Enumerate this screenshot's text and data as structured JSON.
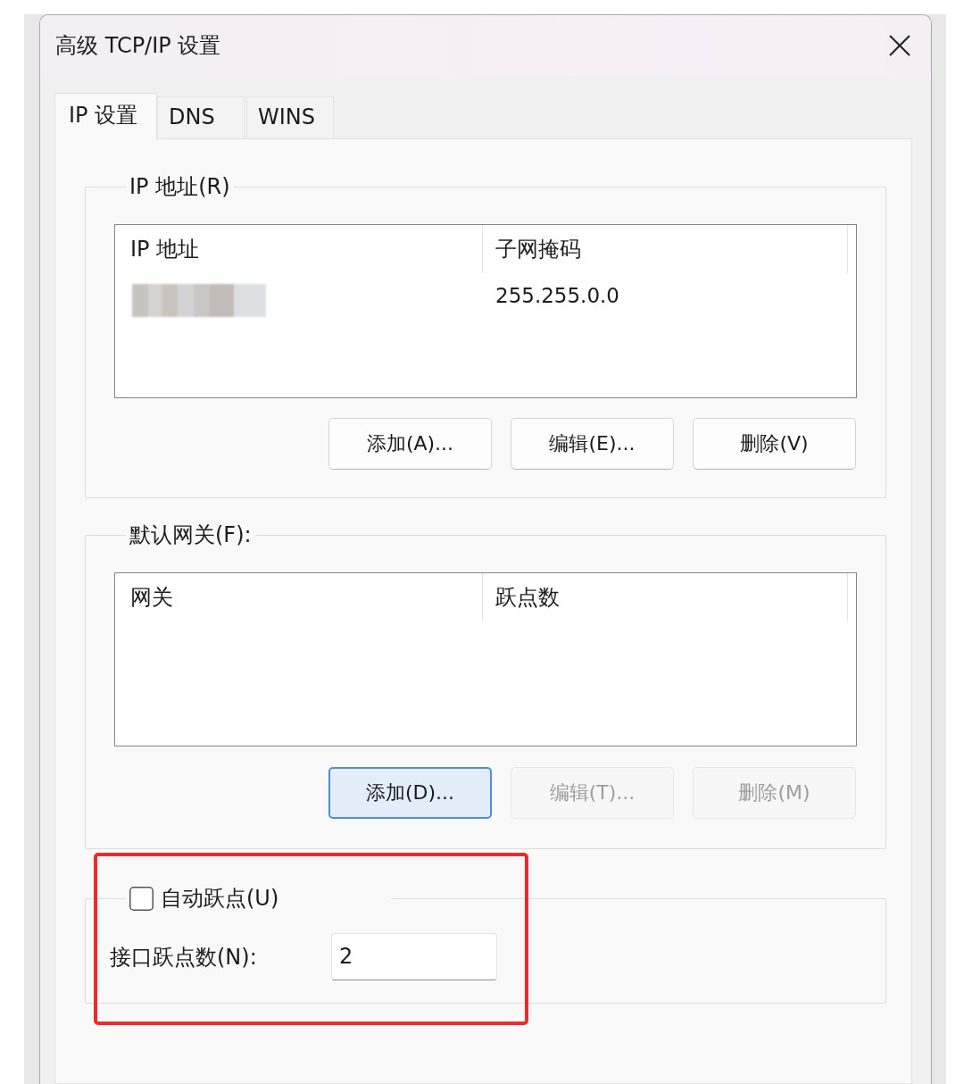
{
  "window": {
    "title": "高级 TCP/IP 设置"
  },
  "tabs": [
    {
      "label": "IP 设置",
      "selected": true
    },
    {
      "label": "DNS",
      "selected": false
    },
    {
      "label": "WINS",
      "selected": false
    }
  ],
  "ip_addresses": {
    "legend": "IP 地址(R)",
    "columns": [
      "IP 地址",
      "子网掩码"
    ],
    "rows": [
      [
        {
          "kind": "redacted"
        },
        {
          "kind": "text",
          "text": "255.255.0.0"
        }
      ]
    ],
    "buttons": [
      {
        "label": "添加(A)...",
        "disabled": false,
        "focused": false
      },
      {
        "label": "编辑(E)...",
        "disabled": false,
        "focused": false
      },
      {
        "label": "删除(V)",
        "disabled": false,
        "focused": false
      }
    ]
  },
  "default_gateways": {
    "legend": "默认网关(F):",
    "columns": [
      "网关",
      "跃点数"
    ],
    "buttons": [
      {
        "label": "添加(D)...",
        "disabled": false,
        "focused": true
      },
      {
        "label": "编辑(T)...",
        "disabled": true,
        "focused": false
      },
      {
        "label": "删除(M)",
        "disabled": true,
        "focused": false
      }
    ]
  },
  "auto_metric": {
    "checkbox": {
      "label": "自动跃点(U)",
      "checked": false
    },
    "metric_label": "接口跃点数(N):",
    "metric_value": "2",
    "highlighted": true
  }
}
